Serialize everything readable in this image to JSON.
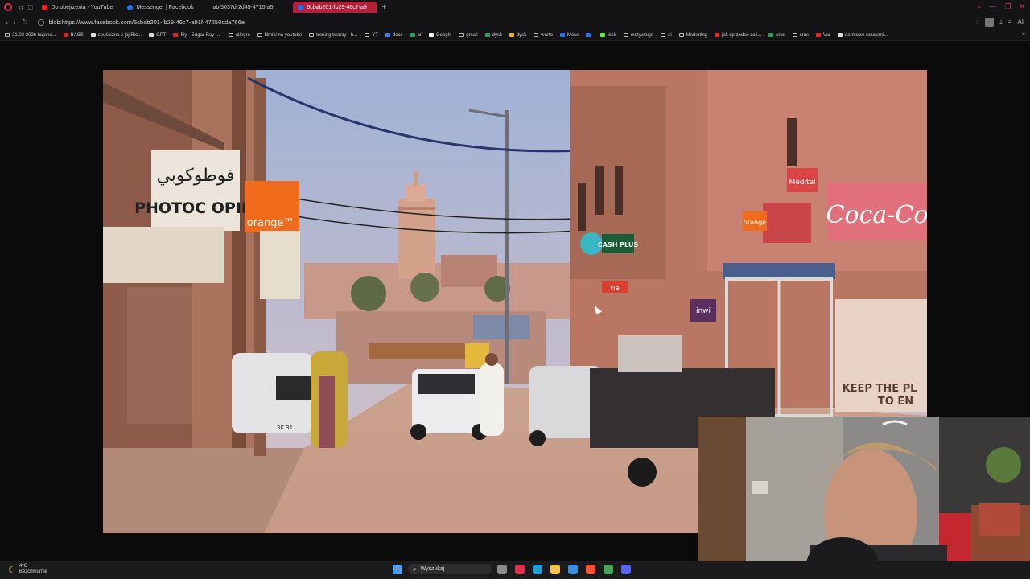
{
  "browser": {
    "tab_tools": [
      "‹›",
      "□"
    ],
    "tabs": [
      {
        "label": "Do obejrzenia - YouTube",
        "icon": "youtube-icon",
        "color": "#e22"
      },
      {
        "label": "Messenger | Facebook",
        "icon": "facebook-icon",
        "color": "#1877f2"
      },
      {
        "label": "abf5037d-2d45-4710-a5",
        "icon": "",
        "color": "#555"
      },
      {
        "label": "5cbab201-fb29-46c7-a9",
        "icon": "facebook-icon",
        "color": "#1877f2",
        "active": true
      }
    ],
    "new_tab": "+",
    "url": "blob:https://www.facebook.com/5cbab201-fb29-46c7-a91f-47250cda766e",
    "right_label": "AI"
  },
  "bookmarks": [
    {
      "label": "21.02 2026 hujano...",
      "type": "folder"
    },
    {
      "label": "BASS",
      "type": "youtube"
    },
    {
      "label": "spuścizna z jaj Ric...",
      "type": "site"
    },
    {
      "label": "GPT",
      "type": "site"
    },
    {
      "label": "Fly - Sugar Ray -...",
      "type": "youtube"
    },
    {
      "label": "allegro",
      "type": "folder"
    },
    {
      "label": "filmiki na youtube",
      "type": "folder"
    },
    {
      "label": "trening twarzy - h...",
      "type": "folder"
    },
    {
      "label": "YT",
      "type": "folder"
    },
    {
      "label": "docs",
      "type": "docs"
    },
    {
      "label": "ar",
      "type": "sheets"
    },
    {
      "label": "Google",
      "type": "google"
    },
    {
      "label": "gmail",
      "type": "folder"
    },
    {
      "label": "dysk",
      "type": "sheets"
    },
    {
      "label": "dysk",
      "type": "drive"
    },
    {
      "label": "warto",
      "type": "folder"
    },
    {
      "label": "Mess",
      "type": "facebook"
    },
    {
      "label": "",
      "type": "facebook"
    },
    {
      "label": "kick",
      "type": "kick"
    },
    {
      "label": "motywacja",
      "type": "folder"
    },
    {
      "label": "ai",
      "type": "folder"
    },
    {
      "label": "Marketing",
      "type": "folder"
    },
    {
      "label": "jak sprzedać coli...",
      "type": "youtube"
    },
    {
      "label": "srus",
      "type": "sheets"
    },
    {
      "label": "srus",
      "type": "folder"
    },
    {
      "label": "Var",
      "type": "youtube"
    },
    {
      "label": "darmowe usuwani...",
      "type": "site"
    }
  ],
  "bookmarks_more": "»",
  "photo": {
    "signs": {
      "photocopie_arabic": "فوطوكوبي",
      "photocopie": "PHOTOC OPIE",
      "orange": "orange™",
      "orange_small": "orange",
      "cash_plus": "CASH PLUS",
      "ria": "ria",
      "meditel": "Méditel",
      "coca_cola": "Coca-Co",
      "inwi": "inwi",
      "mural_text_1": "KEEP THE PL",
      "mural_text_2": "TO EN",
      "plate": "3K 31"
    }
  },
  "taskbar": {
    "weather_temp": "4°C",
    "weather_desc": "Bezchmurnie",
    "search_placeholder": "Wyszukaj",
    "apps": [
      {
        "name": "task-view",
        "color": "#8c8c8c"
      },
      {
        "name": "opera",
        "color": "#e0304e"
      },
      {
        "name": "edge",
        "color": "#1ea0d6"
      },
      {
        "name": "file-explorer",
        "color": "#f3c34b"
      },
      {
        "name": "notepad",
        "color": "#3b8ede"
      },
      {
        "name": "brave",
        "color": "#fb542b"
      },
      {
        "name": "chrome",
        "color": "#4aa55a"
      },
      {
        "name": "discord",
        "color": "#5865f2"
      }
    ]
  }
}
